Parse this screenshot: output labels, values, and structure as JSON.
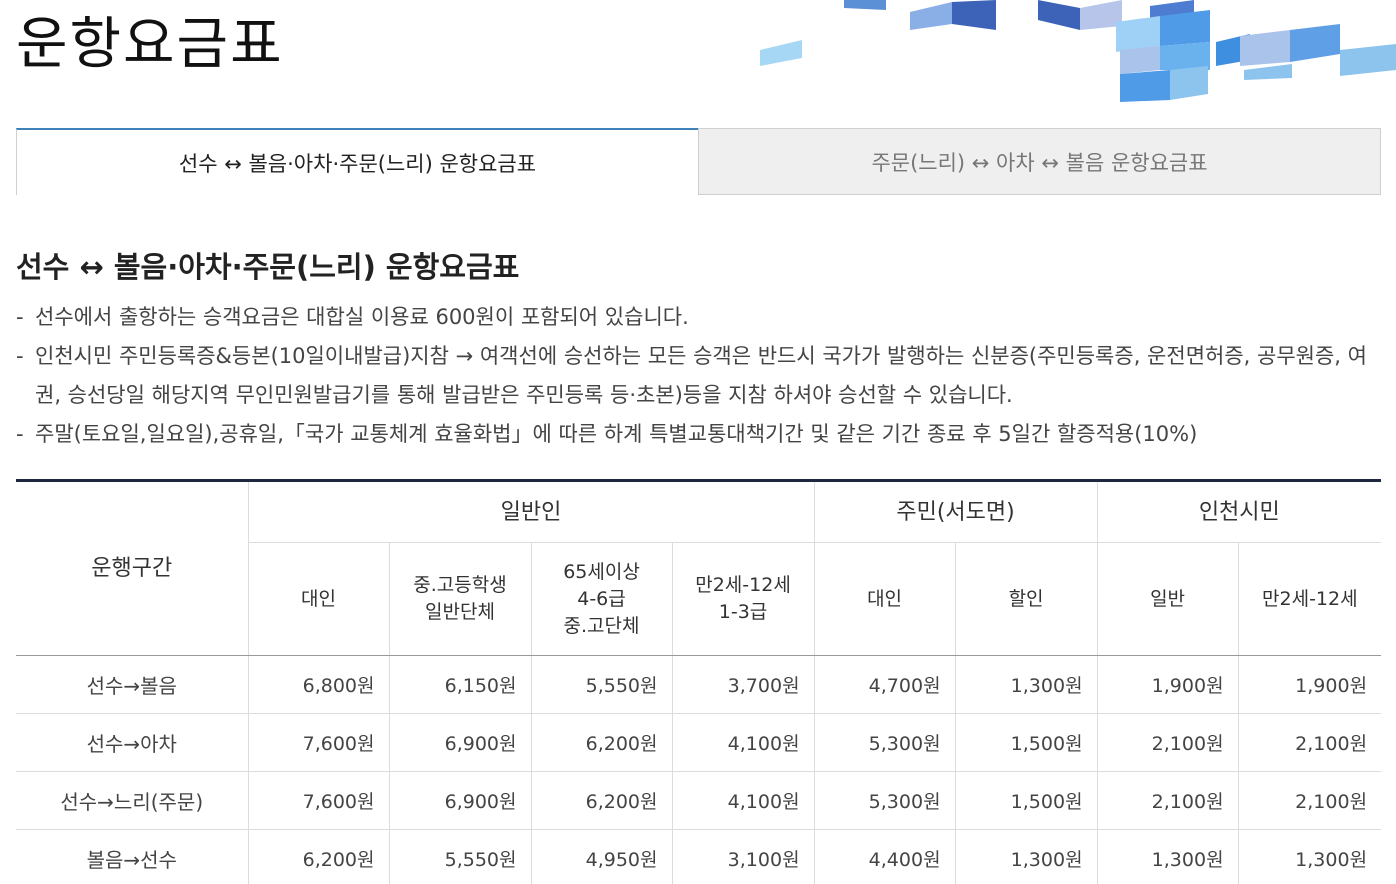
{
  "page_title": "운항요금표",
  "tabs": [
    {
      "label": "선수 ↔ 볼음·아차·주문(느리) 운항요금표",
      "active": true
    },
    {
      "label": "주문(느리) ↔ 아차 ↔ 볼음 운항요금표",
      "active": false
    }
  ],
  "section_title": "선수 ↔ 볼음·아차·주문(느리) 운항요금표",
  "notes": [
    "선수에서 출항하는 승객요금은 대합실 이용료 600원이 포함되어 있습니다.",
    "인천시민 주민등록증&등본(10일이내발급)지참 → 여객선에 승선하는 모든 승객은 반드시 국가가 발행하는 신분증(주민등록증, 운전면허증, 공무원증, 여권, 승선당일 해당지역 무인민원발급기를 통해 발급받은 주민등록 등·초본)등을 지참 하셔야 승선할 수 있습니다.",
    "주말(토요일,일요일),공휴일,「국가 교통체계 효율화법」에 따른 하계 특별교통대책기간 및 같은 기간 종료 후 5일간 할증적용(10%)"
  ],
  "table": {
    "route_header": "운행구간",
    "groups": [
      "일반인",
      "주민(서도면)",
      "인천시민"
    ],
    "subheaders": [
      [
        "대인"
      ],
      [
        "중.고등학생",
        "일반단체"
      ],
      [
        "65세이상",
        "4-6급",
        "중.고단체"
      ],
      [
        "만2세-12세",
        "1-3급"
      ],
      [
        "대인"
      ],
      [
        "할인"
      ],
      [
        "일반"
      ],
      [
        "만2세-12세"
      ]
    ],
    "rows": [
      {
        "route": "선수→볼음",
        "prices": [
          "6,800원",
          "6,150원",
          "5,550원",
          "3,700원",
          "4,700원",
          "1,300원",
          "1,900원",
          "1,900원"
        ]
      },
      {
        "route": "선수→아차",
        "prices": [
          "7,600원",
          "6,900원",
          "6,200원",
          "4,100원",
          "5,300원",
          "1,500원",
          "2,100원",
          "2,100원"
        ]
      },
      {
        "route": "선수→느리(주문)",
        "prices": [
          "7,600원",
          "6,900원",
          "6,200원",
          "4,100원",
          "5,300원",
          "1,500원",
          "2,100원",
          "2,100원"
        ]
      },
      {
        "route": "볼음→선수",
        "prices": [
          "6,200원",
          "5,550원",
          "4,950원",
          "3,100원",
          "4,400원",
          "1,300원",
          "1,300원",
          "1,300원"
        ]
      }
    ]
  },
  "colors": {
    "tab_active_border": "#3f82b9",
    "table_top_border": "#1e2740",
    "decoration_dark": "#3d63b8",
    "decoration_light": "#8cc4ee"
  }
}
